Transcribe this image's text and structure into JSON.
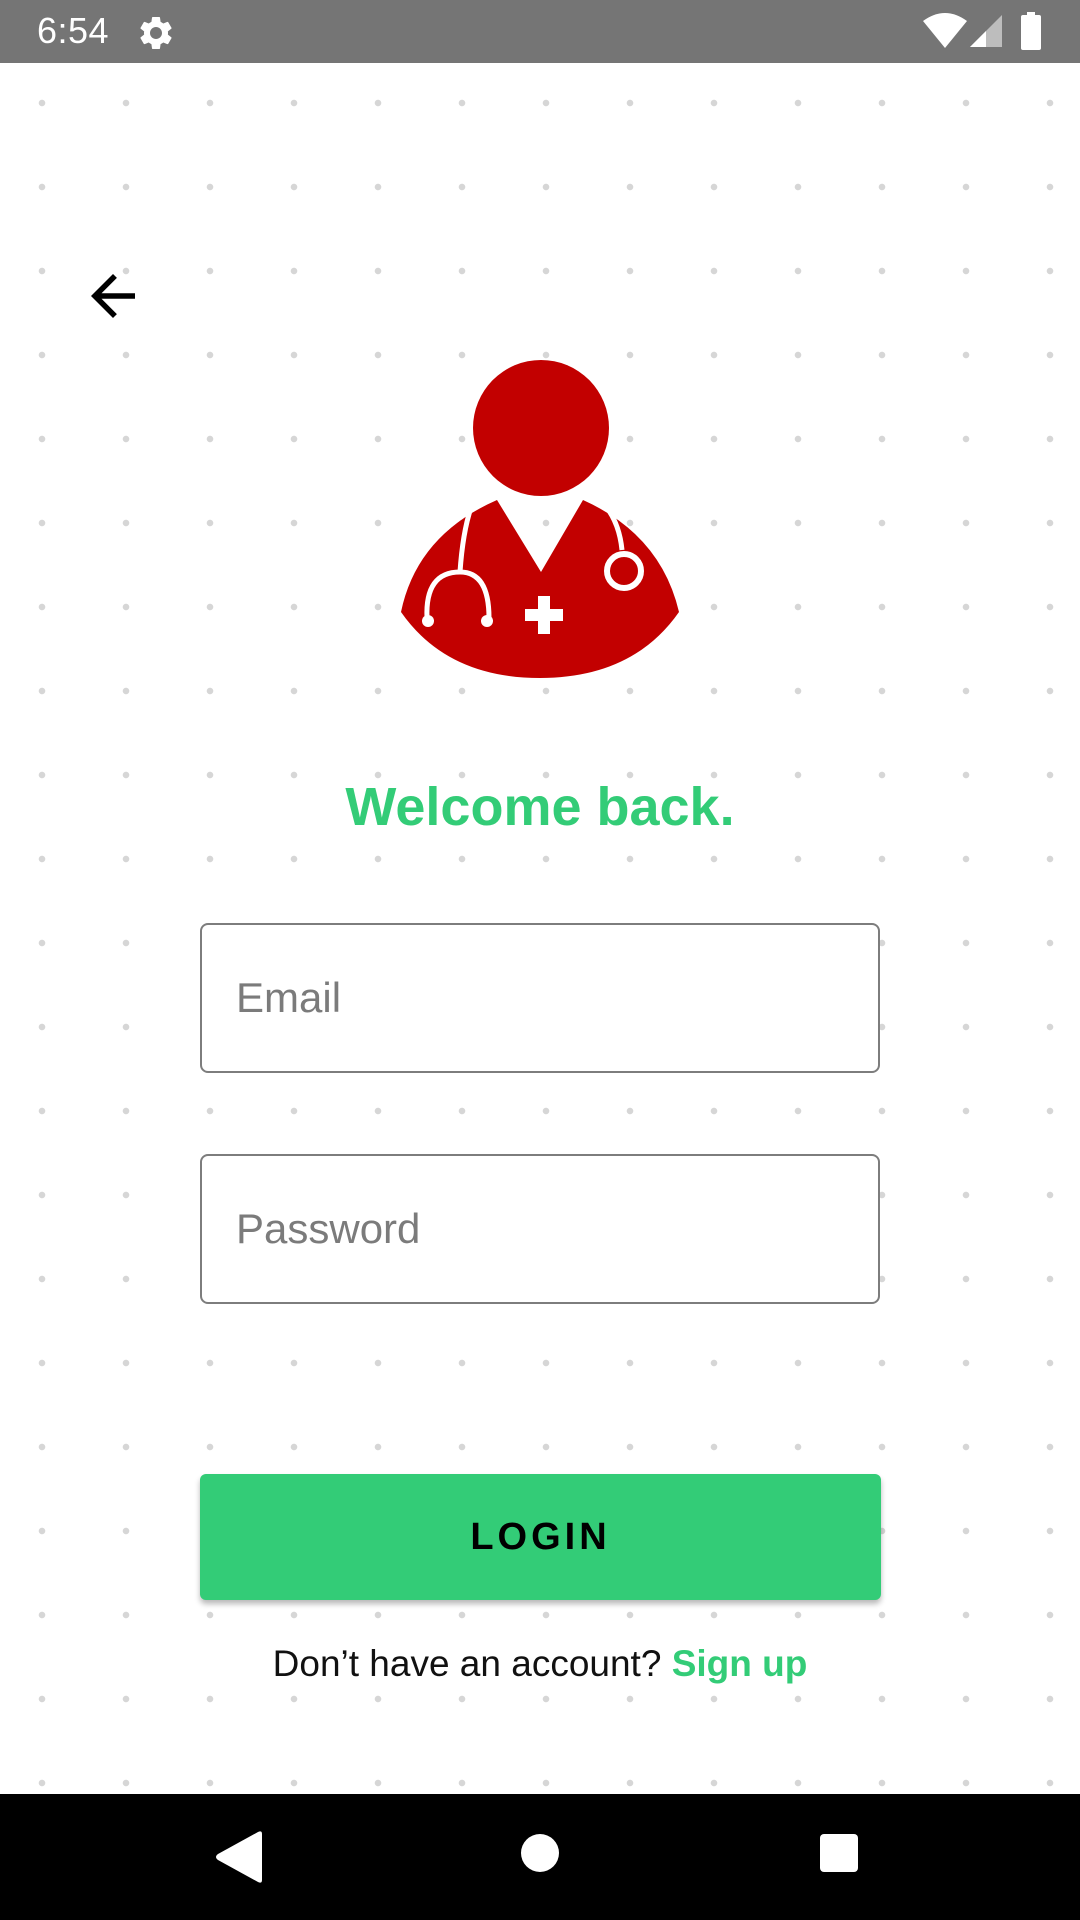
{
  "status_bar": {
    "time": "6:54",
    "icons": [
      "settings-icon",
      "wifi-icon",
      "signal-icon",
      "battery-icon"
    ]
  },
  "header": {
    "back_icon": "arrow-left-icon"
  },
  "avatar": {
    "icon": "doctor-icon",
    "color": "#c20000"
  },
  "welcome": {
    "title": "Welcome back.",
    "color": "#33cc77"
  },
  "form": {
    "email_placeholder": "Email",
    "email_value": "",
    "password_placeholder": "Password",
    "password_value": ""
  },
  "login": {
    "label": "LOGIN",
    "color": "#33cc77"
  },
  "signup": {
    "prompt": "Don’t have an account?",
    "link_label": "Sign up"
  },
  "nav_bar": {
    "icons": [
      "nav-back-icon",
      "nav-home-icon",
      "nav-recents-icon"
    ]
  }
}
